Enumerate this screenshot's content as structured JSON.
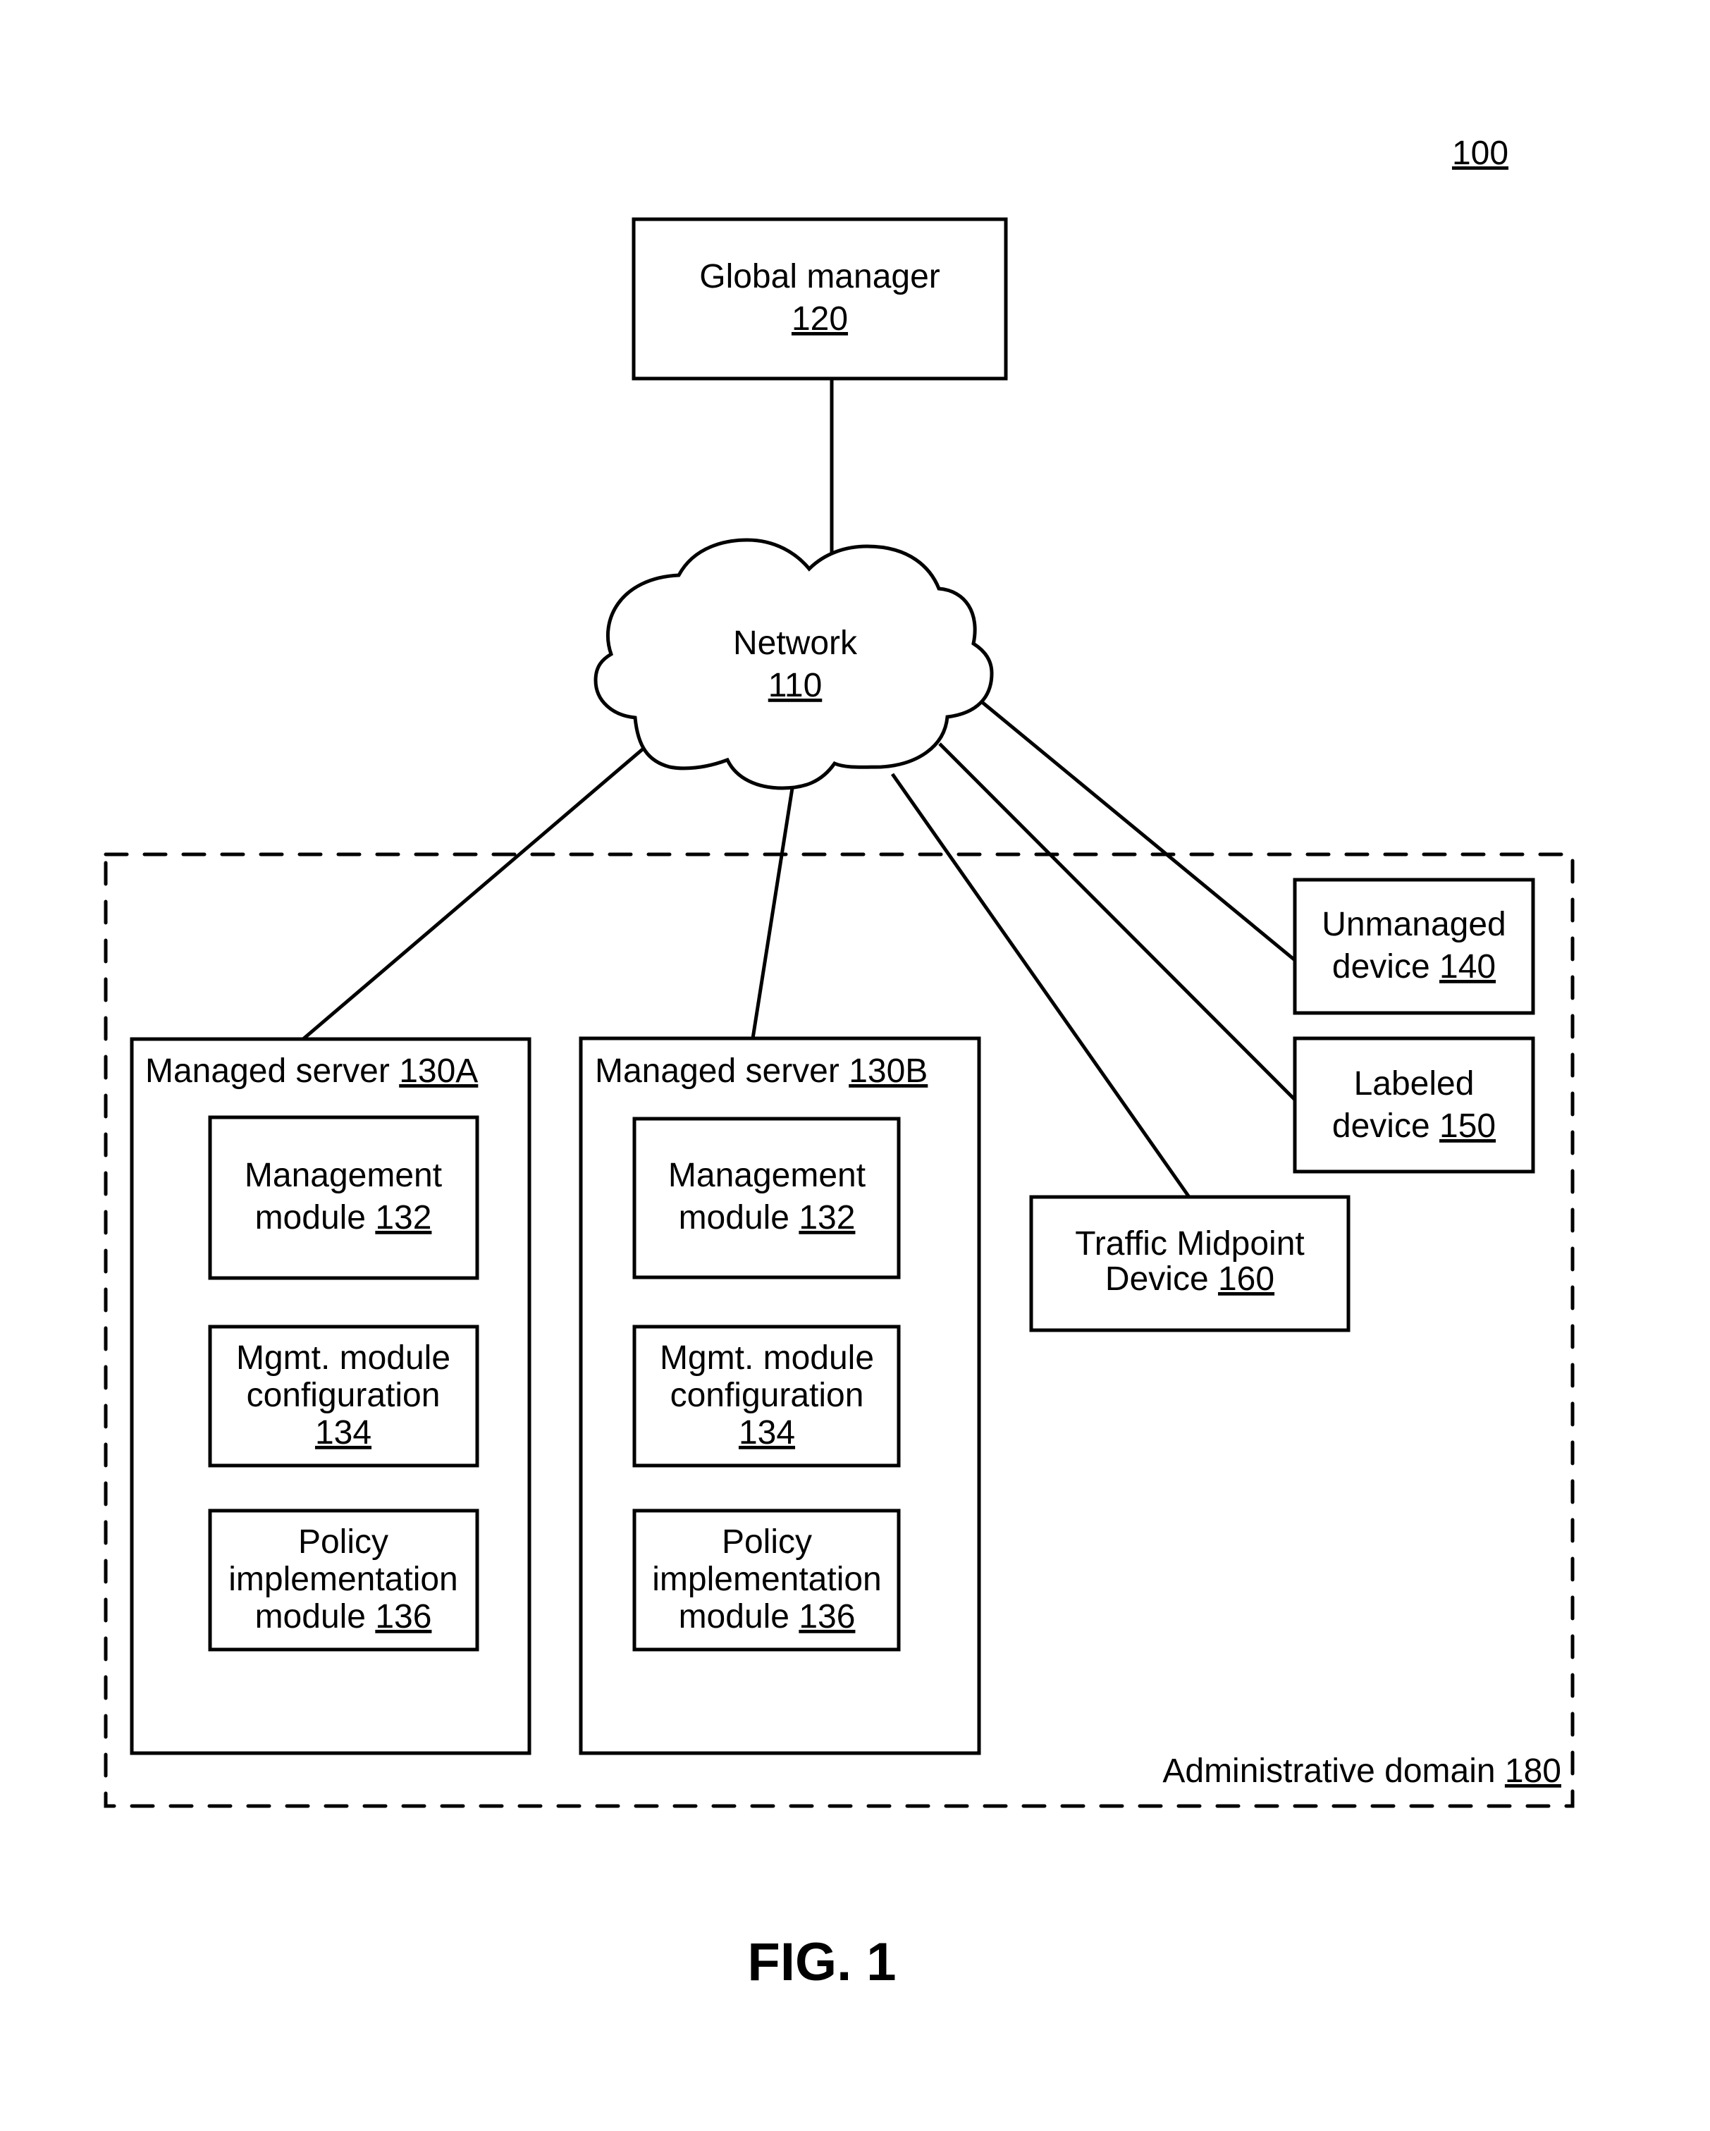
{
  "figure_ref": "100",
  "figure_caption": "FIG. 1",
  "global_manager": {
    "label": "Global manager",
    "ref": "120"
  },
  "network": {
    "label": "Network",
    "ref": "110"
  },
  "admin_domain": {
    "label": "Administrative domain",
    "ref": "180"
  },
  "servers": [
    {
      "label": "Managed server",
      "ref": "130A",
      "modules": [
        {
          "lines": [
            "Management",
            "module"
          ],
          "ref": "132"
        },
        {
          "lines": [
            "Mgmt. module",
            "configuration"
          ],
          "ref": "134"
        },
        {
          "lines": [
            "Policy",
            "implementation",
            "module"
          ],
          "ref": "136"
        }
      ]
    },
    {
      "label": "Managed server",
      "ref": "130B",
      "modules": [
        {
          "lines": [
            "Management",
            "module"
          ],
          "ref": "132"
        },
        {
          "lines": [
            "Mgmt. module",
            "configuration"
          ],
          "ref": "134"
        },
        {
          "lines": [
            "Policy",
            "implementation",
            "module"
          ],
          "ref": "136"
        }
      ]
    }
  ],
  "unmanaged_device": {
    "line1": "Unmanaged",
    "line2": "device",
    "ref": "140"
  },
  "labeled_device": {
    "line1": "Labeled",
    "line2": "device",
    "ref": "150"
  },
  "traffic_midpoint": {
    "line1": "Traffic Midpoint",
    "line2": "Device",
    "ref": "160"
  },
  "colors": {
    "stroke": "#000000",
    "background": "#ffffff"
  }
}
